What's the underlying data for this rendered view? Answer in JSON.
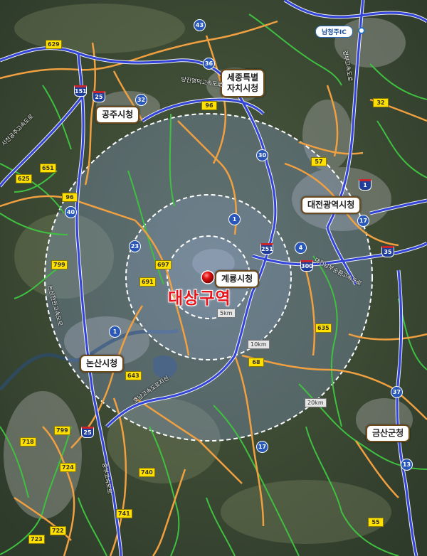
{
  "target_label": "대상구역",
  "cities": [
    {
      "id": "sejong",
      "label": "세종특별\n자치시청"
    },
    {
      "id": "gongju",
      "label": "공주시청"
    },
    {
      "id": "daejeon",
      "label": "대전광역시청"
    },
    {
      "id": "gyeryong",
      "label": "계룡시청"
    },
    {
      "id": "nonsan",
      "label": "논산시청"
    },
    {
      "id": "geumsan",
      "label": "금산군청"
    }
  ],
  "interchange": "남청주IC",
  "ring_labels": [
    "5km",
    "10km",
    "20km"
  ],
  "expressway_labels": [
    "당진영덕고속도로",
    "서천공주고속도로",
    "논산천안고속도로",
    "호남고속도로지선",
    "대전남부순환고속도로",
    "경부고속도로",
    "중부고속도로",
    "호남고속도로"
  ],
  "routes": {
    "local_yellow": [
      "629",
      "96",
      "651",
      "625",
      "96",
      "799",
      "697",
      "691",
      "643",
      "799",
      "718",
      "724",
      "740",
      "741",
      "722",
      "723",
      "57",
      "32",
      "635",
      "68",
      "55"
    ],
    "national_blue": [
      "43",
      "36",
      "32",
      "30",
      "40",
      "23",
      "1",
      "1",
      "4",
      "17",
      "17",
      "37",
      "13"
    ],
    "expressway": [
      "151",
      "25",
      "30",
      "1",
      "251",
      "300",
      "35",
      "25"
    ]
  },
  "colors": {
    "expressway": "#3344d8",
    "national_road": "#f0a040",
    "local_road": "#3fc040",
    "ring": "#ffffff",
    "buffer_fill": "#9fb8ff",
    "target": "#e8141c",
    "city_border": "#6b4a1e"
  }
}
